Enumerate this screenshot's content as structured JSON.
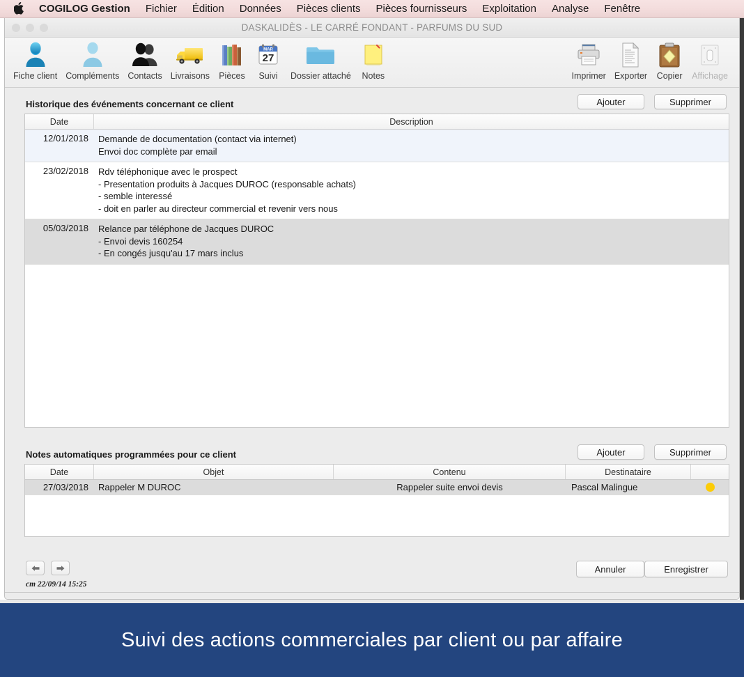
{
  "menubar": {
    "apple_icon": "apple-logo-icon",
    "items": [
      {
        "label": "COGILOG Gestion",
        "bold": true
      },
      {
        "label": "Fichier"
      },
      {
        "label": "Édition"
      },
      {
        "label": "Données"
      },
      {
        "label": "Pièces clients"
      },
      {
        "label": "Pièces fournisseurs"
      },
      {
        "label": "Exploitation"
      },
      {
        "label": "Analyse"
      },
      {
        "label": "Fenêtre"
      }
    ]
  },
  "window": {
    "title": "DASKALIDÈS - LE CARRÉ FONDANT - PARFUMS DU SUD",
    "traffic_lights": [
      "close-button",
      "minimize-button",
      "zoom-button"
    ]
  },
  "toolbar": {
    "left_items": [
      {
        "label": "Fiche client",
        "icon": "person-icon",
        "disabled": false
      },
      {
        "label": "Compléments",
        "icon": "person-light-icon",
        "disabled": false
      },
      {
        "label": "Contacts",
        "icon": "two-people-icon",
        "disabled": false
      },
      {
        "label": "Livraisons",
        "icon": "truck-icon",
        "disabled": false
      },
      {
        "label": "Pièces",
        "icon": "books-icon",
        "disabled": false
      },
      {
        "label": "Suivi",
        "icon": "calendar-icon",
        "disabled": false
      },
      {
        "label": "Dossier attaché",
        "icon": "folder-icon",
        "disabled": false
      },
      {
        "label": "Notes",
        "icon": "sticky-note-icon",
        "disabled": false
      }
    ],
    "right_items": [
      {
        "label": "Imprimer",
        "icon": "printer-icon",
        "disabled": false
      },
      {
        "label": "Exporter",
        "icon": "document-icon",
        "disabled": false
      },
      {
        "label": "Copier",
        "icon": "clipboard-icon",
        "disabled": false
      },
      {
        "label": "Affichage",
        "icon": "display-icon",
        "disabled": true
      }
    ],
    "calendar_month": "MAR",
    "calendar_day": "27"
  },
  "history": {
    "section_title": "Historique des événements concernant ce client",
    "add_label": "Ajouter",
    "delete_label": "Supprimer",
    "columns": [
      "Date",
      "Description"
    ],
    "rows": [
      {
        "date": "12/01/2018",
        "lines": [
          "Demande de documentation (contact via internet)",
          "Envoi doc complète par email"
        ],
        "state": "alt"
      },
      {
        "date": "23/02/2018",
        "lines": [
          "Rdv téléphonique avec le prospect",
          "   - Presentation produits à Jacques DUROC (responsable achats)",
          "   - semble interessé",
          "   - doit en parler au directeur commercial et revenir vers nous"
        ],
        "state": "white"
      },
      {
        "date": "05/03/2018",
        "lines": [
          "Relance par téléphone de Jacques DUROC",
          "   - Envoi devis 160254",
          "   - En congés jusqu'au 17 mars inclus"
        ],
        "state": "sel"
      }
    ]
  },
  "notes": {
    "section_title": "Notes automatiques programmées pour ce client",
    "add_label": "Ajouter",
    "delete_label": "Supprimer",
    "columns": [
      "Date",
      "Objet",
      "Contenu",
      "Destinataire",
      ""
    ],
    "rows": [
      {
        "date": "27/03/2018",
        "objet": "Rappeler M DUROC",
        "contenu": "Rappeler suite envoi devis",
        "destinataire": "Pascal Malingue",
        "flag_color": "#fccc07"
      }
    ]
  },
  "footer": {
    "prev_icon": "arrow-left-icon",
    "next_icon": "arrow-right-icon",
    "cancel_label": "Annuler",
    "save_label": "Enregistrer",
    "stamp": "cm 22/09/14 15:25"
  },
  "caption": {
    "text": "Suivi des actions commerciales par client ou par affaire",
    "background": "#23457f"
  }
}
